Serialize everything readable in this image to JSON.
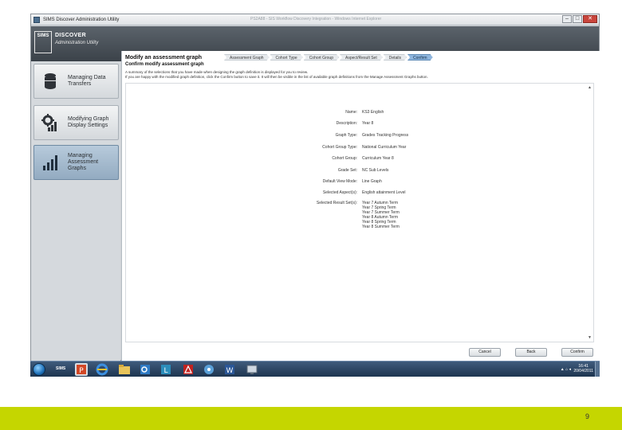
{
  "window": {
    "title": "SIMS Discover Administration Utility",
    "background_tab_text": "PS2A88 - SIS Workflow Discovery Integration - Windows Internet Explorer",
    "controls": {
      "minimize": "–",
      "maximize": "□",
      "close": "✕"
    }
  },
  "header": {
    "logo": "SIMS",
    "brand": "DISCOVER",
    "subtitle": "Administration Utility"
  },
  "sidebar": {
    "items": [
      {
        "label": "Managing Data Transfers",
        "icon": "database-icon",
        "active": false
      },
      {
        "label": "Modifying Graph Display Settings",
        "icon": "gear-chart-icon",
        "active": false
      },
      {
        "label": "Managing Assessment Graphs",
        "icon": "bar-chart-icon",
        "active": true
      }
    ]
  },
  "wizard": {
    "title": "Modify an assessment graph",
    "subtitle": "Confirm modify assessment graph",
    "steps": [
      "Assessment Graph",
      "Cohort Type",
      "Cohort Group",
      "Aspect/Result Set",
      "Details",
      "Confirm"
    ],
    "current_step": "Confirm",
    "summary_line1": "A summary of the selections that you have made when designing the graph definition is displayed for you to review.",
    "summary_line2": "If you are happy with the modified graph definition, click the Confirm button to save it. It will then be visible in the list of available graph definitions from the Manage Assessment Graphs button."
  },
  "details": {
    "rows": [
      {
        "label": "Name:",
        "value": "KS3 English"
      },
      {
        "label": "Description:",
        "value": "Year 8"
      },
      {
        "label": "Graph Type:",
        "value": "Grades Tracking Progress"
      },
      {
        "label": "Cohort Group Type:",
        "value": "National Curriculum Year"
      },
      {
        "label": "Cohort Group:",
        "value": "Curriculum Year 8"
      },
      {
        "label": "Grade Set:",
        "value": "NC Sub Levels"
      },
      {
        "label": "Default View Mode:",
        "value": "Line Graph"
      },
      {
        "label": "Selected Aspect(s):",
        "value": "English attainment Level"
      }
    ],
    "result_sets_label": "Selected Result Set(s):",
    "result_sets": [
      "Year 7 Autumn Term",
      "Year 7 Spring Term",
      "Year 7 Summer Term",
      "Year 8 Autumn Term",
      "Year 8 Spring Term",
      "Year 8 Summer Term"
    ],
    "scroll_up": "▲",
    "scroll_down": "▼"
  },
  "buttons": {
    "cancel": "Cancel",
    "back": "Back",
    "confirm": "Confirm"
  },
  "taskbar": {
    "sims_label": "SIMS",
    "tray": "▲ ⌂ ◂",
    "time": "16:41",
    "date": "20/04/2011"
  },
  "slide": {
    "page_number": "9",
    "band_color": "#c5d600"
  }
}
